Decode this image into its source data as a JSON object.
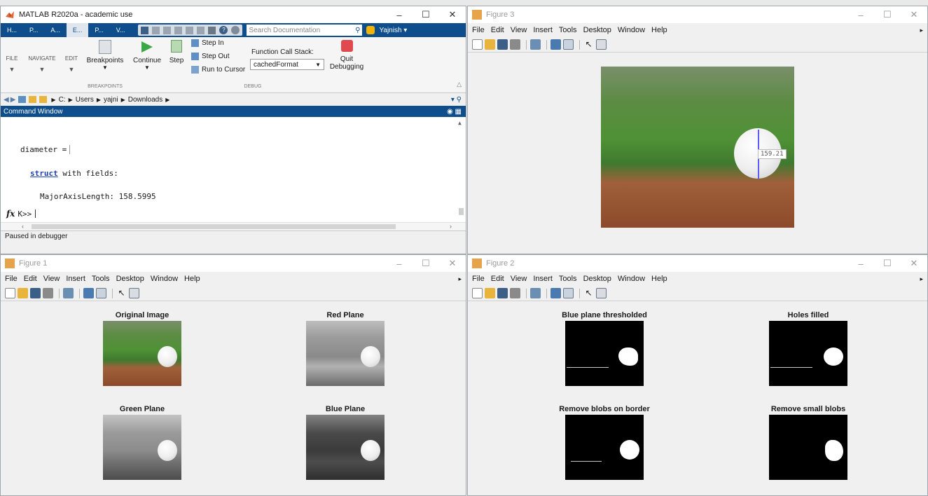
{
  "matlab": {
    "title": "MATLAB R2020a - academic use",
    "tabs": [
      "H...",
      "P...",
      "A...",
      "E...",
      "P...",
      "V..."
    ],
    "search_placeholder": "Search Documentation",
    "user": "Yajnish",
    "ribbon": {
      "file": "FILE",
      "navigate": "NAVIGATE",
      "edit": "EDIT",
      "breakpoints": "Breakpoints",
      "breakpoints_section": "BREAKPOINTS",
      "continue": "Continue",
      "step": "Step",
      "step_in": "Step In",
      "step_out": "Step Out",
      "run_to_cursor": "Run to Cursor",
      "call_stack_label": "Function Call Stack:",
      "call_stack_value": "cachedFormat",
      "quit": "Quit",
      "debugging": "Debugging",
      "debug_section": "DEBUG"
    },
    "path": [
      "C:",
      "Users",
      "yajni",
      "Downloads"
    ],
    "command_window_title": "Command Window",
    "console": {
      "line1": "diameter =",
      "struct_kw": "struct",
      "with_fields": " with fields:",
      "field_line": "MajorAxisLength: 158.5995",
      "prompt": "K>>"
    },
    "status": "Paused in debugger"
  },
  "menu_items": [
    "File",
    "Edit",
    "View",
    "Insert",
    "Tools",
    "Desktop",
    "Window",
    "Help"
  ],
  "figure3": {
    "title": "Figure 3",
    "measure_label": "159.21"
  },
  "figure1": {
    "title": "Figure 1",
    "panels": [
      "Original Image",
      "Red Plane",
      "Green Plane",
      "Blue Plane"
    ]
  },
  "figure2": {
    "title": "Figure 2",
    "panels": [
      "Blue plane thresholded",
      "Holes filled",
      "Remove blobs on border",
      "Remove small blobs"
    ]
  },
  "colors": {
    "matlab_blue": "#0e4e8c",
    "quit_red": "#e0494d",
    "continue_green": "#3aa845"
  }
}
